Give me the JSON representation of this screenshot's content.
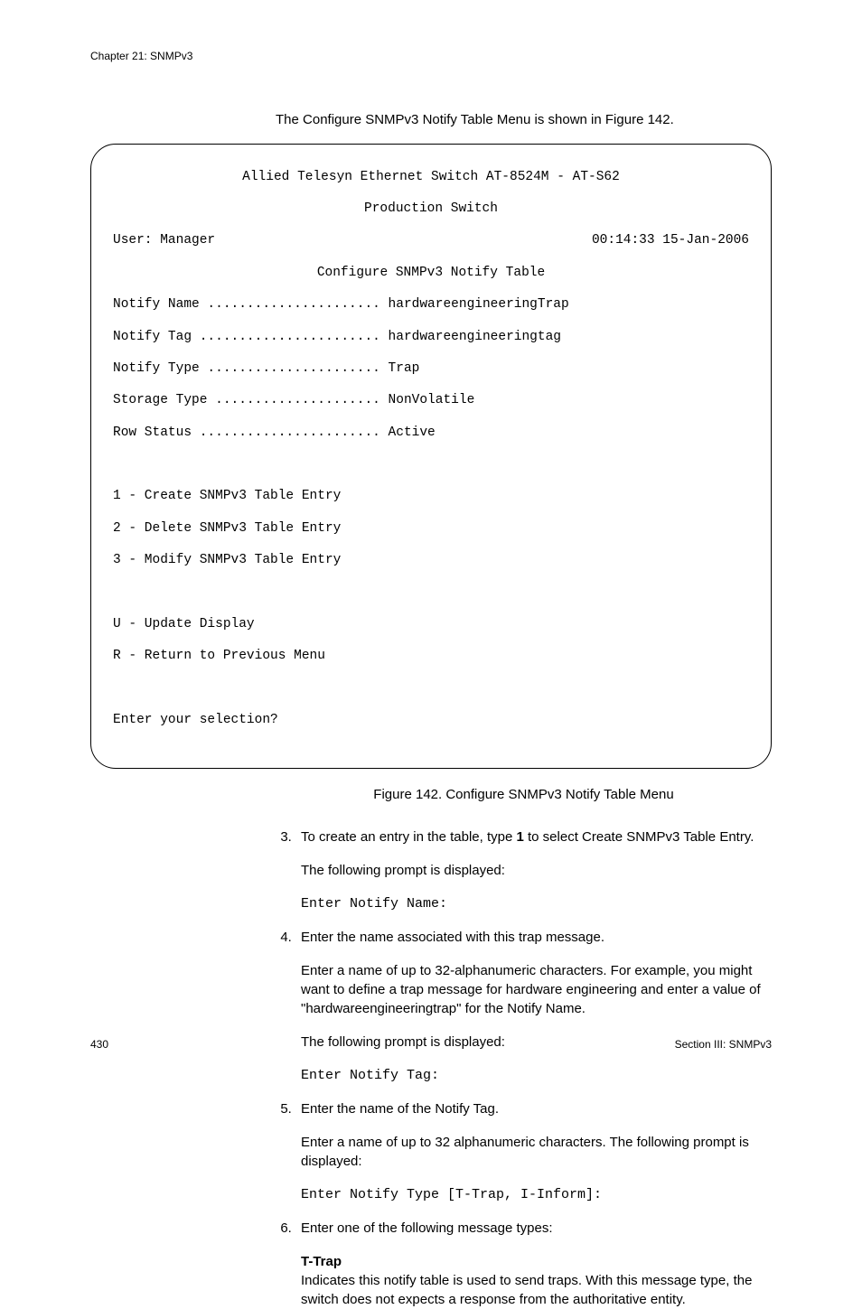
{
  "header": {
    "chapter": "Chapter 21: SNMPv3"
  },
  "intro": "The Configure SNMPv3 Notify Table Menu is shown in Figure 142.",
  "terminal": {
    "title_line1": "Allied Telesyn Ethernet Switch AT-8524M - AT-S62",
    "title_line2": "Production Switch",
    "user_label": "User: Manager",
    "timestamp": "00:14:33 15-Jan-2006",
    "section_title": "Configure SNMPv3 Notify Table",
    "rows": {
      "r1": "Notify Name ...................... hardwareengineeringTrap",
      "r2": "Notify Tag ....................... hardwareengineeringtag",
      "r3": "Notify Type ...................... Trap",
      "r4": "Storage Type ..................... NonVolatile",
      "r5": "Row Status ....................... Active"
    },
    "menu": {
      "m1": "1 - Create SNMPv3 Table Entry",
      "m2": "2 - Delete SNMPv3 Table Entry",
      "m3": "3 - Modify SNMPv3 Table Entry",
      "mU": "U - Update Display",
      "mR": "R - Return to Previous Menu"
    },
    "prompt": "Enter your selection?"
  },
  "caption": "Figure 142. Configure SNMPv3 Notify Table Menu",
  "steps": {
    "s3a": "To create an entry in the table, type ",
    "s3b_bold": "1",
    "s3c": " to select Create SNMPv3 Table Entry.",
    "s3p1": "The following prompt is displayed:",
    "s3code": "Enter Notify Name:",
    "s4a": "Enter the name associated with this trap message.",
    "s4p1": "Enter a name of up to 32-alphanumeric characters. For example, you might want to define a trap message for hardware engineering and enter a value of \"hardwareengineeringtrap\" for the Notify Name.",
    "s4p2": "The following prompt is displayed:",
    "s4code": "Enter Notify Tag:",
    "s5a": "Enter the name of the Notify Tag.",
    "s5p1": "Enter a name of up to 32 alphanumeric characters. The following prompt is displayed:",
    "s5code": "Enter Notify Type [T-Trap, I-Inform]:",
    "s6a": "Enter one of the following message types:",
    "s6h": "T-Trap",
    "s6p1": "Indicates this notify table is used to send traps. With this message type, the switch does not expects a response from the authoritative entity."
  },
  "footer": {
    "page_num": "430",
    "section": "Section III: SNMPv3"
  }
}
